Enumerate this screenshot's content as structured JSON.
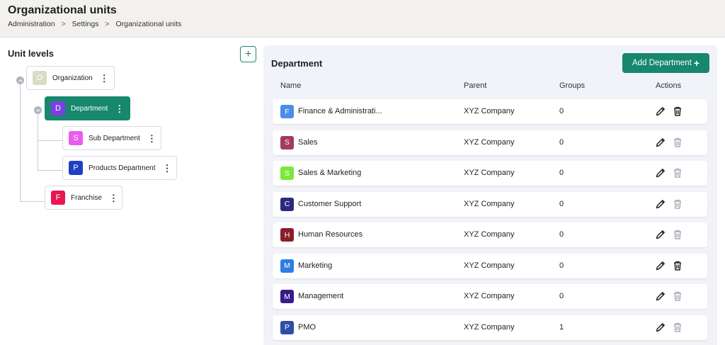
{
  "header": {
    "title": "Organizational units",
    "breadcrumb": [
      "Administration",
      "Settings",
      "Organizational units"
    ],
    "breadcrumb_separator": ">"
  },
  "left_panel": {
    "title": "Unit levels",
    "add_icon": "plus-icon",
    "tree": [
      {
        "letter": "O",
        "label": "Organization",
        "color": "#d8dcc4"
      },
      {
        "letter": "D",
        "label": "Department",
        "color": "#7b3fe4",
        "selected": true
      },
      {
        "letter": "S",
        "label": "Sub Department",
        "color": "#ea5cf0"
      },
      {
        "letter": "P",
        "label": "Products Department",
        "color": "#1f3fc4"
      },
      {
        "letter": "F",
        "label": "Franchise",
        "color": "#e8174f"
      }
    ]
  },
  "right_panel": {
    "title": "Department",
    "add_button_label": "Add Department",
    "add_button_icon": "plus-icon",
    "columns": {
      "name": "Name",
      "parent": "Parent",
      "groups": "Groups",
      "actions": "Actions"
    },
    "rows": [
      {
        "letter": "F",
        "name": "Finance & Administrati...",
        "parent": "XYZ Company",
        "groups": "0",
        "color": "#4a8fe7",
        "delete_enabled": true
      },
      {
        "letter": "S",
        "name": "Sales",
        "parent": "XYZ Company",
        "groups": "0",
        "color": "#a63a5e",
        "delete_enabled": false
      },
      {
        "letter": "S",
        "name": "Sales & Marketing",
        "parent": "XYZ Company",
        "groups": "0",
        "color": "#7ee83a",
        "delete_enabled": false
      },
      {
        "letter": "C",
        "name": "Customer Support",
        "parent": "XYZ Company",
        "groups": "0",
        "color": "#2b2a7e",
        "delete_enabled": false
      },
      {
        "letter": "H",
        "name": "Human Resources",
        "parent": "XYZ Company",
        "groups": "0",
        "color": "#8a1f2b",
        "delete_enabled": false
      },
      {
        "letter": "M",
        "name": "Marketing",
        "parent": "XYZ Company",
        "groups": "0",
        "color": "#2f7de0",
        "delete_enabled": true
      },
      {
        "letter": "M",
        "name": "Management",
        "parent": "XYZ Company",
        "groups": "0",
        "color": "#3a1a8a",
        "delete_enabled": false
      },
      {
        "letter": "P",
        "name": "PMO",
        "parent": "XYZ Company",
        "groups": "1",
        "color": "#2e4fa6",
        "delete_enabled": false
      }
    ],
    "edit_icon": "pencil-icon",
    "delete_icon": "trash-icon"
  },
  "colors": {
    "accent": "#17876e",
    "disabled_icon": "#a8adb8"
  }
}
